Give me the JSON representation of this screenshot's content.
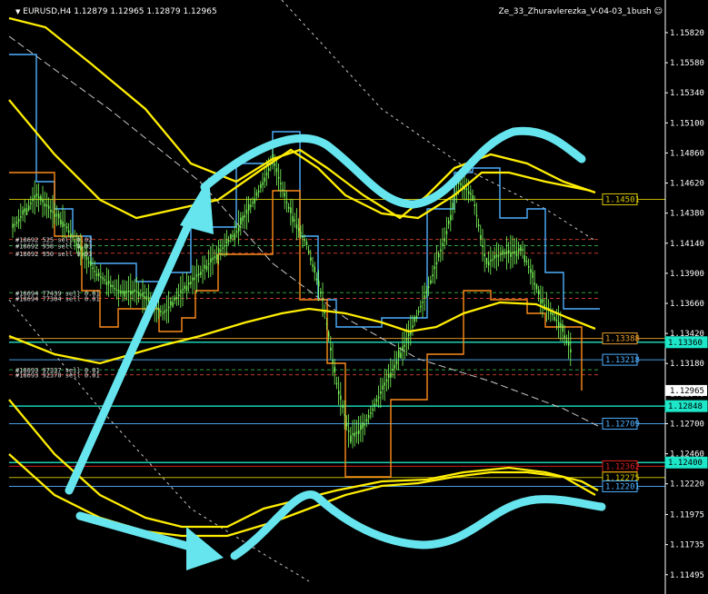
{
  "header": {
    "symbol_info": "EURUSD,H4  1.12879 1.12965 1.12879 1.12965",
    "indicator": "Ze_33_Zhuravlerezka_V-04-03_1bush"
  },
  "chart_data": {
    "type": "candlestick",
    "symbol": "EURUSD",
    "timeframe": "H4",
    "ylim": [
      1.1137,
      1.1595
    ],
    "price_axis_ticks": [
      "1.15820",
      "1.15580",
      "1.15340",
      "1.15100",
      "1.14860",
      "1.14620",
      "1.14380",
      "1.14140",
      "1.13900",
      "1.13660",
      "1.13420",
      "1.13180",
      "1.12940",
      "1.12700",
      "1.12460",
      "1.12220",
      "1.11975",
      "1.11735",
      "1.11495"
    ],
    "current_price": "1.12965",
    "price_labels": [
      {
        "value": "1.14501",
        "price": 1.1449,
        "color": "#d8c800",
        "style": "box"
      },
      {
        "value": "1.13388",
        "price": 1.1338,
        "color": "#e8a030",
        "style": "box"
      },
      {
        "value": "1.13360",
        "price": 1.1335,
        "color": "#1ee6c8",
        "style": "filled"
      },
      {
        "value": "1.13218",
        "price": 1.1321,
        "color": "#4fb0ff",
        "style": "box"
      },
      {
        "value": "1.12848",
        "price": 1.1284,
        "color": "#1ee6c8",
        "style": "filled"
      },
      {
        "value": "1.12709",
        "price": 1.127,
        "color": "#4fb0ff",
        "style": "box"
      },
      {
        "value": "1.12400",
        "price": 1.1239,
        "color": "#1ee6c8",
        "style": "filled"
      },
      {
        "value": "1.12362",
        "price": 1.1236,
        "color": "#e02020",
        "style": "box"
      },
      {
        "value": "1.12275",
        "price": 1.1227,
        "color": "#d8c800",
        "style": "box"
      },
      {
        "value": "1.12201",
        "price": 1.122,
        "color": "#4fb0ff",
        "style": "box"
      }
    ],
    "order_labels": [
      {
        "text": "#18692 525 sell 0.02",
        "price": 1.1417
      },
      {
        "text": "#18692 958 sell 0.03",
        "price": 1.1412
      },
      {
        "text": "#18692 950 sell 0.03",
        "price": 1.1406
      },
      {
        "text": "#18694 77439 sell 0.01",
        "price": 1.13745
      },
      {
        "text": "#18694 77304 sell 0.01",
        "price": 1.137
      },
      {
        "text": "#18693 97337 sell 0.01",
        "price": 1.1313
      },
      {
        "text": "#18693 92378 sell 0.01",
        "price": 1.1309
      }
    ],
    "colors": {
      "background": "#000000",
      "candles": "#7cff5a",
      "upper_step": "#4fb0ff",
      "lower_step": "#ff8c1a",
      "bands": "#ffee00",
      "arrows": "#66e5ee",
      "guide": "#c8c8c8"
    }
  }
}
